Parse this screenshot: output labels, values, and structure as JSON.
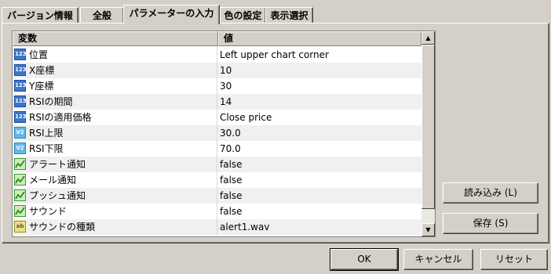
{
  "tabs": [
    {
      "label": "バージョン情報"
    },
    {
      "label": "全般"
    },
    {
      "label": "パラメーターの入力"
    },
    {
      "label": "色の設定"
    },
    {
      "label": "表示選択"
    }
  ],
  "grid": {
    "headers": {
      "name": "変数",
      "value": "値"
    },
    "rows": [
      {
        "icon": "123",
        "name": "位置",
        "value": "Left upper chart corner"
      },
      {
        "icon": "123",
        "name": "X座標",
        "value": "10"
      },
      {
        "icon": "123",
        "name": "Y座標",
        "value": "30"
      },
      {
        "icon": "123",
        "name": "RSIの期間",
        "value": "14"
      },
      {
        "icon": "123",
        "name": "RSIの適用価格",
        "value": "Close price"
      },
      {
        "icon": "V2",
        "name": "RSI上限",
        "value": "30.0"
      },
      {
        "icon": "V2",
        "name": "RSI下限",
        "value": "70.0"
      },
      {
        "icon": "",
        "name": "アラート通知",
        "value": "false"
      },
      {
        "icon": "",
        "name": "メール通知",
        "value": "false"
      },
      {
        "icon": "",
        "name": "プッシュ通知",
        "value": "false"
      },
      {
        "icon": "",
        "name": "サウンド",
        "value": "false"
      },
      {
        "icon": "ab",
        "name": "サウンドの種類",
        "value": "alert1.wav"
      }
    ]
  },
  "side_buttons": {
    "load": "読み込み (L)",
    "save": "保存 (S)"
  },
  "footer_buttons": {
    "ok": "OK",
    "cancel": "キャンセル",
    "reset": "リセット"
  }
}
